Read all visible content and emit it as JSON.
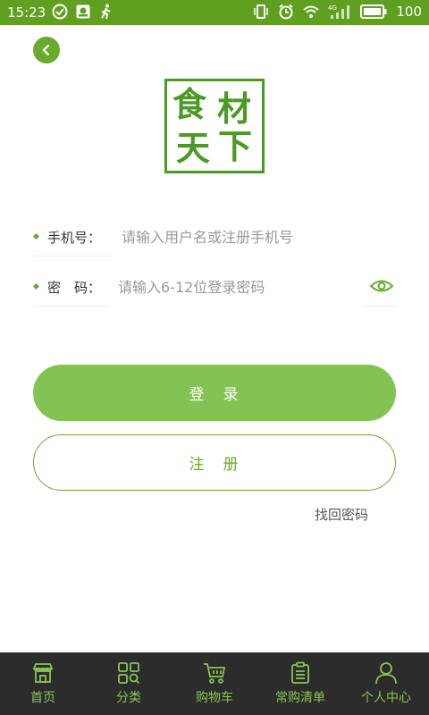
{
  "status_bar": {
    "time": "15:23",
    "battery": "100",
    "network": "4G"
  },
  "logo": {
    "chars": [
      "食",
      "材",
      "天",
      "下"
    ]
  },
  "form": {
    "phone": {
      "label": "手机号：",
      "placeholder": "请输入用户名或注册手机号",
      "value": ""
    },
    "password": {
      "label": "密　码：",
      "placeholder": "请输入6-12位登录密码",
      "value": ""
    }
  },
  "buttons": {
    "login": "登　录",
    "register": "注　册",
    "forgot": "找回密码"
  },
  "tabbar": {
    "items": [
      {
        "label": "首页",
        "icon": "store-icon"
      },
      {
        "label": "分类",
        "icon": "category-search-icon"
      },
      {
        "label": "购物车",
        "icon": "cart-icon"
      },
      {
        "label": "常购清单",
        "icon": "clipboard-icon"
      },
      {
        "label": "个人中心",
        "icon": "person-icon"
      }
    ]
  },
  "colors": {
    "brand_green": "#5fa020",
    "button_green": "#83c353",
    "tabbar_bg": "#2c2c2c",
    "tab_label": "#87c64f"
  }
}
